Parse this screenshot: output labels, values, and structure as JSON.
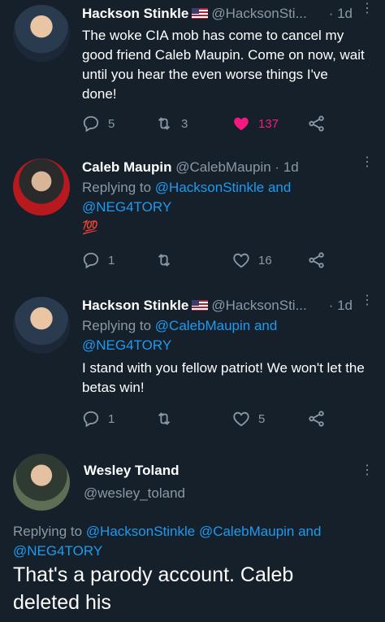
{
  "tweets": [
    {
      "name": "Hackson Stinkle",
      "handle": "@HacksonSti...",
      "time": "· 1d",
      "text": "The woke CIA mob has come to cancel my good friend Caleb Maupin. Come on now, wait until you hear the even worse things I've done!",
      "replies": "5",
      "retweets": "3",
      "likes": "137",
      "avatar_icon": "person-avatar-icon"
    },
    {
      "name": "Caleb Maupin",
      "handle": "@CalebMaupin · 1d",
      "reply_prefix": "Replying to",
      "mention1": "@HacksonStinkle and",
      "mention2": "@NEG4TORY",
      "text": "💯",
      "replies": "1",
      "likes": "16"
    },
    {
      "name": "Hackson Stinkle",
      "handle": "@HacksonSti...",
      "time": "· 1d",
      "reply_prefix": "Replying to",
      "mention1": "@CalebMaupin and",
      "mention2": "@NEG4TORY",
      "text": "I stand with you fellow patriot! We won't let the betas win!",
      "replies": "1",
      "likes": "5"
    }
  ],
  "main_tweet": {
    "name": "Wesley Toland",
    "handle": "@wesley_toland",
    "reply_prefix": "Replying to",
    "mentions_line1": "@HacksonStinkle @CalebMaupin and",
    "mentions_line2": "@NEG4TORY",
    "text": "That's a parody account. Caleb deleted his"
  },
  "colors": {
    "background": "#15202b",
    "secondary_text": "#8b98a5",
    "link": "#1d9bf0",
    "like_active": "#f91880"
  }
}
